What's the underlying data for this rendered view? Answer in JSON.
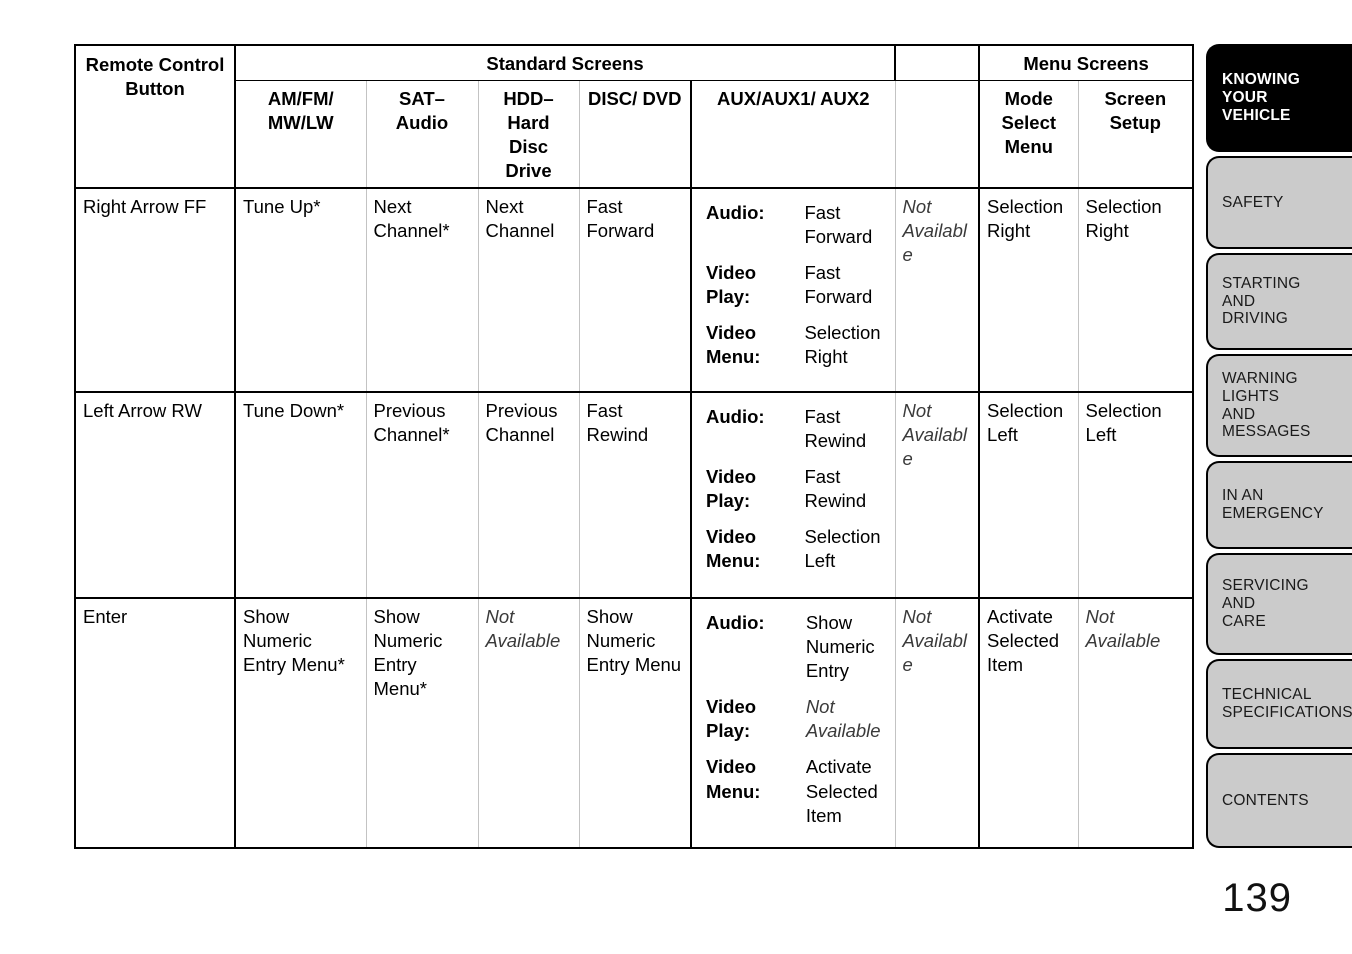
{
  "page": {
    "number": "139"
  },
  "table": {
    "group_headers": {
      "remote_control": "Remote Control Button",
      "standard_screens": "Standard Screens",
      "menu_screens": "Menu Screens"
    },
    "columns": [
      "AM/FM/\nMW/LW",
      "SAT–\nAudio",
      "HDD–\nHard\nDisc\nDrive",
      "DISC/\nDVD",
      "AUX/AUX1/\nAUX2",
      "",
      "Mode\nSelect\nMenu",
      "Screen\nSetup"
    ],
    "rows": [
      {
        "button": "Right Arrow FF",
        "amfm": "Tune Up*",
        "sat": "Next Channel*",
        "hdd": "Next Channel",
        "disc": "Fast Forward",
        "aux": [
          {
            "label": "Audio:",
            "value": "Fast Forward",
            "italic": false
          },
          {
            "label": "Video Play:",
            "value": "Fast Forward",
            "italic": false
          },
          {
            "label": "Video Menu:",
            "value": "Selection Right",
            "italic": false
          }
        ],
        "extra": {
          "text": "Not Available",
          "italic": true
        },
        "mode_select": {
          "text": "Selection Right",
          "italic": false
        },
        "screen_setup": {
          "text": "Selection Right",
          "italic": false
        }
      },
      {
        "button": "Left Arrow RW",
        "amfm": "Tune Down*",
        "sat": "Previous Channel*",
        "hdd": "Previous Channel",
        "disc": "Fast Rewind",
        "aux": [
          {
            "label": "Audio:",
            "value": "Fast Rewind",
            "italic": false
          },
          {
            "label": "Video Play:",
            "value": "Fast Rewind",
            "italic": false
          },
          {
            "label": "Video Menu:",
            "value": "Selection Left",
            "italic": false
          }
        ],
        "extra": {
          "text": "Not Available",
          "italic": true
        },
        "mode_select": {
          "text": "Selection Left",
          "italic": false
        },
        "screen_setup": {
          "text": "Selection Left",
          "italic": false
        }
      },
      {
        "button": "Enter",
        "amfm": "Show Numeric Entry Menu*",
        "sat": "Show Numeric Entry Menu*",
        "hdd": "Not Available",
        "hdd_italic": true,
        "disc": "Show Numeric Entry Menu",
        "aux": [
          {
            "label": "Audio:",
            "value": "Show Numeric Entry",
            "italic": false
          },
          {
            "label": "Video Play:",
            "value": "Not Available",
            "italic": true
          },
          {
            "label": "Video Menu:",
            "value": "Activate Selected Item",
            "italic": false
          }
        ],
        "extra": {
          "text": "Not Available",
          "italic": true
        },
        "mode_select": {
          "text": "Activate Selected Item",
          "italic": false
        },
        "screen_setup": {
          "text": "Not Available",
          "italic": true
        }
      }
    ]
  },
  "sidebar": {
    "tabs": [
      {
        "label": "KNOWING\nYOUR\nVEHICLE",
        "active": true
      },
      {
        "label": "SAFETY",
        "active": false
      },
      {
        "label": "STARTING\nAND\nDRIVING",
        "active": false
      },
      {
        "label": "WARNING\nLIGHTS\nAND\nMESSAGES",
        "active": false
      },
      {
        "label": "IN AN\nEMERGENCY",
        "active": false
      },
      {
        "label": "SERVICING\nAND\nCARE",
        "active": false
      },
      {
        "label": "TECHNICAL\nSPECIFICATIONS",
        "active": false
      },
      {
        "label": "CONTENTS",
        "active": false
      }
    ]
  }
}
